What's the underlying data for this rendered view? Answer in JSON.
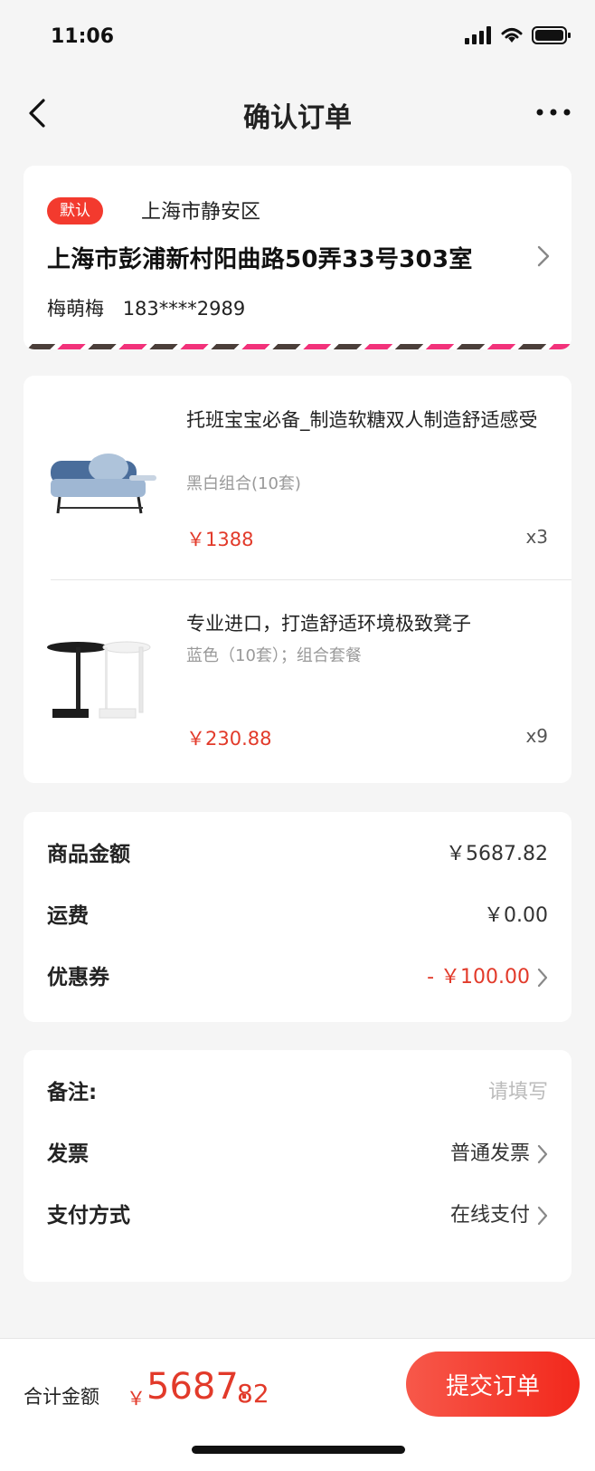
{
  "status_bar": {
    "time": "11:06"
  },
  "nav": {
    "title": "确认订单"
  },
  "address": {
    "badge": "默认",
    "region": "上海市静安区",
    "detail": "上海市彭浦新村阳曲路50弄33号303室",
    "name": "梅萌梅",
    "phone": "183****2989"
  },
  "goods": [
    {
      "name": "托班宝宝必备_制造软糖双人制造舒适感受",
      "spec": "黑白组合(10套)",
      "price": "￥1388",
      "qty": "x3"
    },
    {
      "name": "专业进口，打造舒适环境极致凳子",
      "spec": "蓝色（10套）；组合套餐",
      "price": "￥230.88",
      "qty": "x9"
    }
  ],
  "amounts": {
    "goods_label": "商品金额",
    "goods_value": "￥5687.82",
    "shipping_label": "运费",
    "shipping_value": "￥0.00",
    "coupon_label": "优惠券",
    "coupon_value": "- ￥100.00"
  },
  "extras": {
    "remark_label": "备注:",
    "remark_placeholder": "请填写",
    "invoice_label": "发票",
    "invoice_value": "普通发票",
    "payment_label": "支付方式",
    "payment_value": "在线支付"
  },
  "footer": {
    "total_label": "合计金额",
    "currency": "￥",
    "total_int": "5687.",
    "total_dec": "82",
    "submit_label": "提交订单"
  },
  "colors": {
    "accent": "#e23a2a",
    "badge": "#f33a2e",
    "submit_start": "#f7584a",
    "submit_end": "#f2281c",
    "background": "#f5f5f5"
  }
}
